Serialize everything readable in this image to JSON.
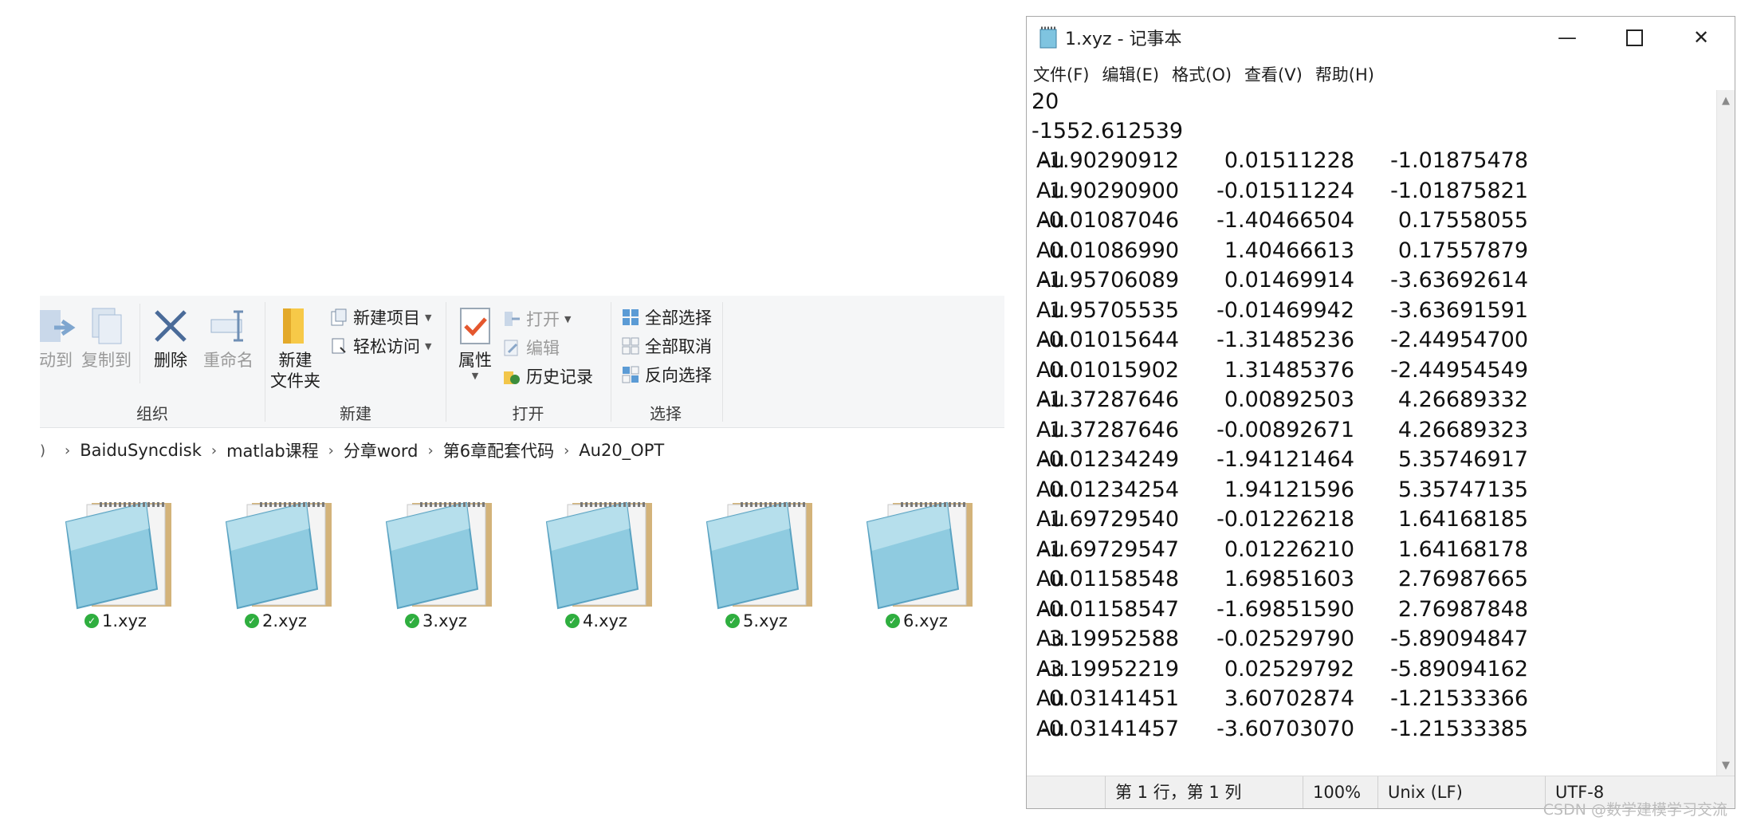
{
  "ribbon": {
    "groups": {
      "organize": {
        "title": "组织",
        "move_to": "动到",
        "copy_to": "复制到",
        "delete": "删除",
        "rename": "重命名"
      },
      "new": {
        "title": "新建",
        "new_folder_line1": "新建",
        "new_folder_line2": "文件夹",
        "new_item": "新建项目",
        "easy_access": "轻松访问"
      },
      "open": {
        "title": "打开",
        "properties": "属性",
        "open": "打开",
        "edit": "编辑",
        "history": "历史记录"
      },
      "select": {
        "title": "选择",
        "select_all": "全部选择",
        "select_none": "全部取消",
        "invert": "反向选择"
      }
    }
  },
  "address": {
    "crumbs": [
      "BaiduSyncdisk",
      "matlab课程",
      "分章word",
      "第6章配套代码",
      "Au20_OPT"
    ]
  },
  "files": [
    {
      "name": "1.xyz"
    },
    {
      "name": "2.xyz"
    },
    {
      "name": "3.xyz"
    },
    {
      "name": "4.xyz"
    },
    {
      "name": "5.xyz"
    },
    {
      "name": "6.xyz"
    }
  ],
  "notepad": {
    "title": "1.xyz - 记事本",
    "menu": [
      "文件(F)",
      "编辑(E)",
      "格式(O)",
      "查看(V)",
      "帮助(H)"
    ],
    "line1": "20",
    "line2": "-1552.612539",
    "atoms": [
      [
        "Au",
        "-1.90290912",
        "0.01511228",
        "-1.01875478"
      ],
      [
        "Au",
        "1.90290900",
        "-0.01511224",
        "-1.01875821"
      ],
      [
        "Au",
        "-0.01087046",
        "-1.40466504",
        "0.17558055"
      ],
      [
        "Au",
        "0.01086990",
        "1.40466613",
        "0.17557879"
      ],
      [
        "Au",
        "-1.95706089",
        "0.01469914",
        "-3.63692614"
      ],
      [
        "Au",
        "1.95705535",
        "-0.01469942",
        "-3.63691591"
      ],
      [
        "Au",
        "-0.01015644",
        "-1.31485236",
        "-2.44954700"
      ],
      [
        "Au",
        "0.01015902",
        "1.31485376",
        "-2.44954549"
      ],
      [
        "Au",
        "-1.37287646",
        "0.00892503",
        "4.26689332"
      ],
      [
        "Au",
        "1.37287646",
        "-0.00892671",
        "4.26689323"
      ],
      [
        "Au",
        "-0.01234249",
        "-1.94121464",
        "5.35746917"
      ],
      [
        "Au",
        "0.01234254",
        "1.94121596",
        "5.35747135"
      ],
      [
        "Au",
        "1.69729540",
        "-0.01226218",
        "1.64168185"
      ],
      [
        "Au",
        "-1.69729547",
        "0.01226210",
        "1.64168178"
      ],
      [
        "Au",
        "0.01158548",
        "1.69851603",
        "2.76987665"
      ],
      [
        "Au",
        "-0.01158547",
        "-1.69851590",
        "2.76987848"
      ],
      [
        "Au",
        "3.19952588",
        "-0.02529790",
        "-5.89094847"
      ],
      [
        "Au",
        "-3.19952219",
        "0.02529792",
        "-5.89094162"
      ],
      [
        "Au",
        "0.03141451",
        "3.60702874",
        "-1.21533366"
      ],
      [
        "Au",
        "-0.03141457",
        "-3.60703070",
        "-1.21533385"
      ]
    ],
    "status": {
      "position": "第 1 行，第 1 列",
      "zoom": "100%",
      "eol": "Unix (LF)",
      "encoding": "UTF-8"
    }
  },
  "watermark": "CSDN @数学建模学习交流"
}
